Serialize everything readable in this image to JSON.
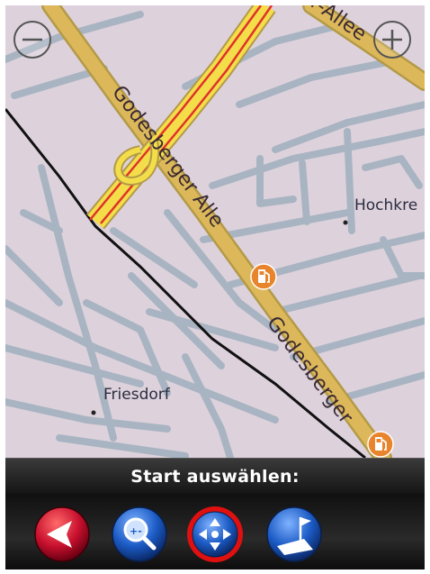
{
  "map": {
    "street_labels": [
      "Godesberger Alle",
      "Godesberger",
      "r-Allee"
    ],
    "place_labels": [
      "Hochkre",
      "Friesdorf"
    ],
    "colors": {
      "background": "#ddd2dc",
      "minor_road": "#a9b4c2",
      "major_road": "#ddb85a",
      "highway_fill": "#f3de4a",
      "highway_center": "#e0322a",
      "railway": "#111111",
      "poi": "#e8842c"
    }
  },
  "controls": {
    "zoom_out_icon": "zoom-out-icon",
    "zoom_in_icon": "zoom-in-icon"
  },
  "poi": {
    "icon": "fuel-station-icon"
  },
  "status": {
    "text": "Start auswählen:"
  },
  "toolbar": {
    "buttons": [
      {
        "icon": "back-arrow-icon",
        "color": "#c8102e"
      },
      {
        "icon": "zoom-search-icon",
        "color": "#1c5bc5"
      },
      {
        "icon": "pan-arrows-icon",
        "color": "#1c5bc5",
        "selected": true,
        "highlight": "#e01010"
      },
      {
        "icon": "destination-flag-icon",
        "color": "#1c5bc5"
      }
    ]
  }
}
